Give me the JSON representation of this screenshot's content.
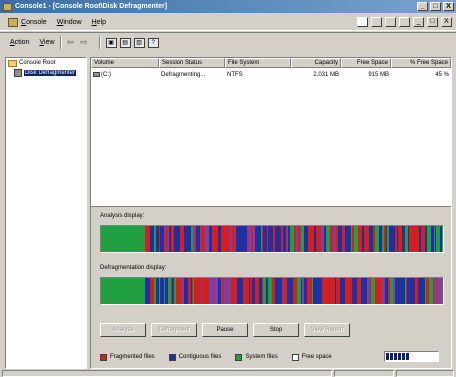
{
  "window": {
    "title": "Console1 - [Console Root\\Disk Defragmenter]",
    "title_buttons": [
      "_",
      "□",
      "X"
    ]
  },
  "menubar": {
    "items": [
      "Console",
      "Window",
      "Help"
    ],
    "right_buttons": [
      "_",
      "□",
      "X"
    ]
  },
  "toolbar": {
    "action_label": "Action",
    "view_label": "View"
  },
  "tree": {
    "root_label": "Console Root",
    "child_label": "Disk Defragmenter"
  },
  "volume_list": {
    "columns": [
      "Volume",
      "Session Status",
      "File System",
      "Capacity",
      "Free Space",
      "% Free Space"
    ],
    "rows": [
      {
        "volume": "(C:)",
        "session_status": "Defragmenting...",
        "file_system": "NTFS",
        "capacity": "2,031 MB",
        "free_space": "915 MB",
        "pct_free": "45 %"
      }
    ]
  },
  "analysis": {
    "label": "Analysis display:"
  },
  "defrag": {
    "label": "Defragmentation display:"
  },
  "buttons": {
    "analyze": "Analyze",
    "defragment": "Defragment",
    "pause": "Pause",
    "stop": "Stop",
    "view_report": "View Report"
  },
  "legend": {
    "fragmented": "Fragmented files",
    "contiguous": "Contiguous files",
    "system": "System files",
    "free": "Free space"
  },
  "colors": {
    "fragmented": "#d02020",
    "contiguous": "#2030a0",
    "system": "#20a040",
    "free": "#ffffff",
    "title_bar": "#3a6ea5"
  },
  "progress": {
    "fraction": 0.45
  }
}
